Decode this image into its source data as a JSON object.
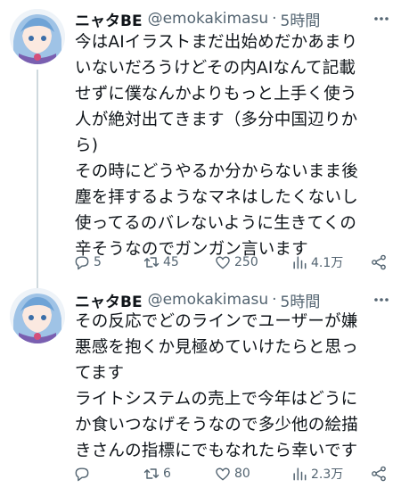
{
  "colors": {
    "text": "#0f1419",
    "secondary": "#536471",
    "thread_line": "#cfd9de"
  },
  "tweets": [
    {
      "author": "ニャタBE",
      "handle": "@emokakimasu",
      "separator": "·",
      "time": "5時間",
      "lines": [
        "今はAIイラストまだ出始めだかあまり",
        "いないだろうけどその内AIなんて記載",
        "せずに僕なんかよりもっと上手く使う",
        "人が絶対出てきます（多分中国辺りか",
        "ら)",
        "その時にどうやるか分からないまま後",
        "塵を拝するようなマネはしたくないし",
        "使ってるのバレないように生きてくの",
        "辛そうなのでガンガン言います"
      ],
      "stats": {
        "replies": "5",
        "retweets": "45",
        "likes": "250",
        "views": "4.1万"
      }
    },
    {
      "author": "ニャタBE",
      "handle": "@emokakimasu",
      "separator": "·",
      "time": "5時間",
      "lines": [
        "その反応でどのラインでユーザーが嫌",
        "悪感を抱くか見極めていけたらと思っ",
        "てます",
        "ライトシステムの売上で今年はどうに",
        "か食いつなげそうなので多少他の絵描",
        "きさんの指標にでもなれたら幸いです"
      ],
      "stats": {
        "replies": "",
        "retweets": "6",
        "likes": "80",
        "views": "2.3万"
      }
    }
  ],
  "icons": [
    "more-icon",
    "reply-icon",
    "retweet-icon",
    "like-icon",
    "views-icon",
    "share-icon"
  ]
}
